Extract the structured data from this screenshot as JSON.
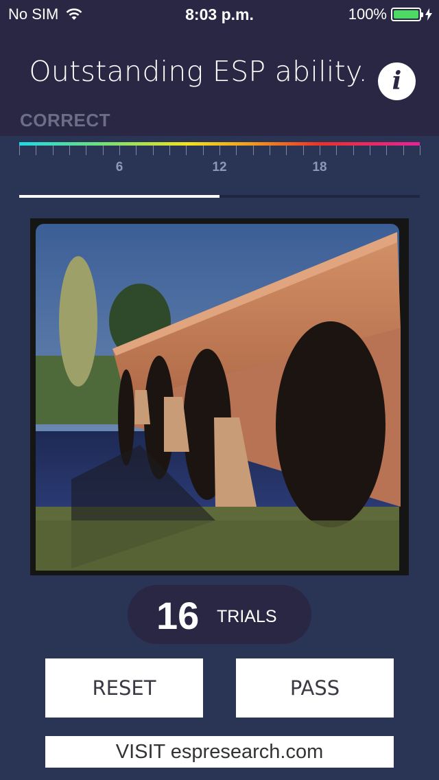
{
  "status_bar": {
    "carrier": "No SIM",
    "time": "8:03 p.m.",
    "battery": "100%"
  },
  "header": {
    "message": "Outstanding ESP ability.",
    "info_icon": "info-icon",
    "info_glyph": "i"
  },
  "score": {
    "label": "CORRECT",
    "tick_labels": [
      "6",
      "12",
      "18"
    ],
    "max": 24,
    "progress_fraction": 0.5
  },
  "trials": {
    "count": "16",
    "label": "TRIALS"
  },
  "buttons": {
    "reset": "RESET",
    "pass": "PASS",
    "visit": "VISIT espresearch.com"
  },
  "colors": {
    "background": "#2a3455",
    "header": "#2a2744",
    "gradient": [
      "#20d8e6",
      "#6ee07a",
      "#f2e21c",
      "#f39a1c",
      "#e8322a",
      "#e82296"
    ]
  }
}
